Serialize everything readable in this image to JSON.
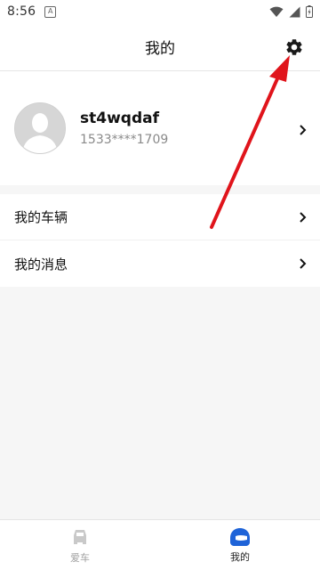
{
  "status_bar": {
    "time": "8:56",
    "notification_icon": "A"
  },
  "header": {
    "title": "我的",
    "settings_icon": "gear-icon"
  },
  "profile": {
    "username": "st4wqdaf",
    "phone": "1533****1709"
  },
  "menu": {
    "items": [
      {
        "label": "我的车辆"
      },
      {
        "label": "我的消息"
      }
    ]
  },
  "tabbar": {
    "tabs": [
      {
        "label": "爱车",
        "active": false
      },
      {
        "label": "我的",
        "active": true
      }
    ]
  },
  "colors": {
    "accent": "#1e63d8",
    "annotation": "#e0141b",
    "background": "#f6f6f6"
  }
}
